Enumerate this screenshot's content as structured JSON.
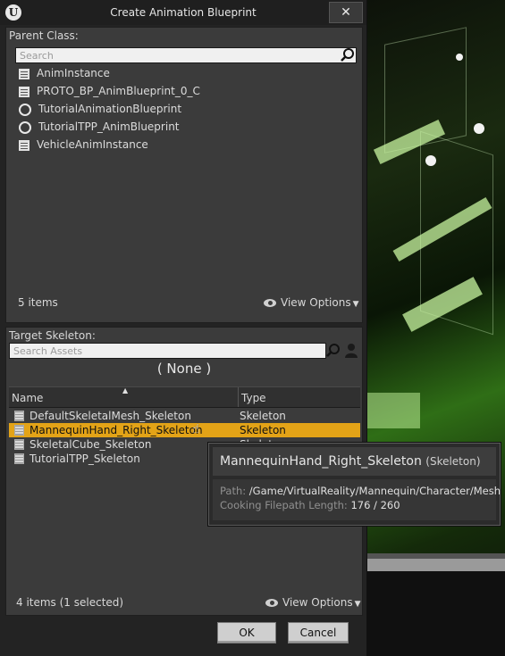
{
  "window": {
    "logo": "U",
    "title": "Create Animation Blueprint",
    "close_label": "✕"
  },
  "parent_class": {
    "label": "Parent Class:",
    "search_placeholder": "Search",
    "items": [
      {
        "icon": "blueprint-icon",
        "label": "AnimInstance"
      },
      {
        "icon": "blueprint-icon",
        "label": "PROTO_BP_AnimBlueprint_0_C"
      },
      {
        "icon": "ring-icon",
        "label": "TutorialAnimationBlueprint"
      },
      {
        "icon": "ring-icon",
        "label": "TutorialTPP_AnimBlueprint"
      },
      {
        "icon": "blueprint-icon",
        "label": "VehicleAnimInstance"
      }
    ],
    "count": "5 items",
    "view_options": "View Options"
  },
  "target_skeleton": {
    "label": "Target Skeleton:",
    "search_placeholder": "Search Assets",
    "none_label": "( None )",
    "columns": {
      "name": "Name",
      "type": "Type"
    },
    "rows": [
      {
        "name": "DefaultSkeletalMesh_Skeleton",
        "type": "Skeleton",
        "selected": false
      },
      {
        "name": "MannequinHand_Right_Skeleton",
        "type": "Skeleton",
        "selected": true
      },
      {
        "name": "SkeletalCube_Skeleton",
        "type": "Skeleton",
        "selected": false
      },
      {
        "name": "TutorialTPP_Skeleton",
        "type": "",
        "selected": false
      }
    ],
    "count": "4 items (1 selected)",
    "view_options": "View Options"
  },
  "tooltip": {
    "title": "MannequinHand_Right_Skeleton",
    "subtitle": "(Skeleton)",
    "path_key": "Path:",
    "path_value": "/Game/VirtualReality/Mannequin/Character/Mesh",
    "cooking_key": "Cooking Filepath Length:",
    "cooking_value": "176 / 260"
  },
  "buttons": {
    "ok": "OK",
    "cancel": "Cancel"
  },
  "colors": {
    "selection": "#e3a317",
    "panel": "#3b3b3b",
    "viewport_green": "#2f6e16"
  }
}
